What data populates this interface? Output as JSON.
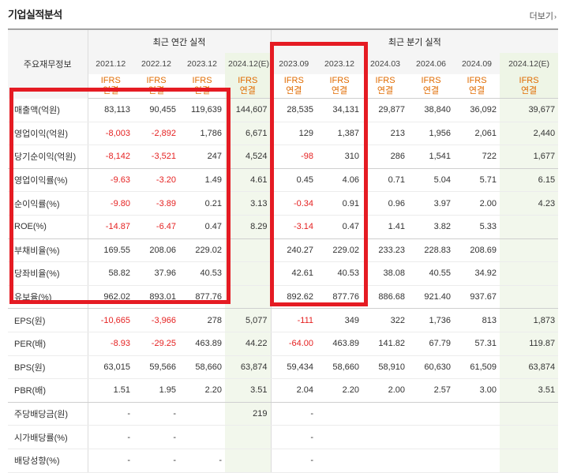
{
  "title": "기업실적분석",
  "more_label": "더보기",
  "label_header": "주요재무정보",
  "annual_header": "최근 연간 실적",
  "quarter_header": "최근 분기 실적",
  "periods": [
    "2021.12",
    "2022.12",
    "2023.12",
    "2024.12(E)",
    "2023.09",
    "2023.12",
    "2024.03",
    "2024.06",
    "2024.09",
    "2024.12(E)"
  ],
  "ifrs": {
    "line1": "IFRS",
    "line2": "연결"
  },
  "rows": [
    {
      "label": "매출액(억원)",
      "values": [
        "83,113",
        "90,455",
        "119,639",
        "144,607",
        "28,535",
        "34,131",
        "29,877",
        "38,840",
        "36,092",
        "39,677"
      ]
    },
    {
      "label": "영업이익(억원)",
      "values": [
        "-8,003",
        "-2,892",
        "1,786",
        "6,671",
        "129",
        "1,387",
        "213",
        "1,956",
        "2,061",
        "2,440"
      ]
    },
    {
      "label": "당기순이익(억원)",
      "values": [
        "-8,142",
        "-3,521",
        "247",
        "4,524",
        "-98",
        "310",
        "286",
        "1,541",
        "722",
        "1,677"
      ]
    },
    {
      "label": "영업이익률(%)",
      "values": [
        "-9.63",
        "-3.20",
        "1.49",
        "4.61",
        "0.45",
        "4.06",
        "0.71",
        "5.04",
        "5.71",
        "6.15"
      ]
    },
    {
      "label": "순이익률(%)",
      "values": [
        "-9.80",
        "-3.89",
        "0.21",
        "3.13",
        "-0.34",
        "0.91",
        "0.96",
        "3.97",
        "2.00",
        "4.23"
      ]
    },
    {
      "label": "ROE(%)",
      "values": [
        "-14.87",
        "-6.47",
        "0.47",
        "8.29",
        "-3.14",
        "0.47",
        "1.41",
        "3.82",
        "5.33",
        ""
      ]
    },
    {
      "label": "부채비율(%)",
      "values": [
        "169.55",
        "208.06",
        "229.02",
        "",
        "240.27",
        "229.02",
        "233.23",
        "228.83",
        "208.69",
        ""
      ]
    },
    {
      "label": "당좌비율(%)",
      "values": [
        "58.82",
        "37.96",
        "40.53",
        "",
        "42.61",
        "40.53",
        "38.08",
        "40.55",
        "34.92",
        ""
      ]
    },
    {
      "label": "유보율(%)",
      "values": [
        "962.02",
        "893.01",
        "877.76",
        "",
        "892.62",
        "877.76",
        "886.68",
        "921.40",
        "937.67",
        ""
      ]
    },
    {
      "label": "EPS(원)",
      "values": [
        "-10,665",
        "-3,966",
        "278",
        "5,077",
        "-111",
        "349",
        "322",
        "1,736",
        "813",
        "1,873"
      ]
    },
    {
      "label": "PER(배)",
      "values": [
        "-8.93",
        "-29.25",
        "463.89",
        "44.22",
        "-64.00",
        "463.89",
        "141.82",
        "67.79",
        "57.31",
        "119.87"
      ]
    },
    {
      "label": "BPS(원)",
      "values": [
        "63,015",
        "59,566",
        "58,660",
        "63,874",
        "59,434",
        "58,660",
        "58,910",
        "60,630",
        "61,509",
        "63,874"
      ]
    },
    {
      "label": "PBR(배)",
      "values": [
        "1.51",
        "1.95",
        "2.20",
        "3.51",
        "2.04",
        "2.20",
        "2.00",
        "2.57",
        "3.00",
        "3.51"
      ]
    },
    {
      "label": "주당배당금(원)",
      "values": [
        "-",
        "-",
        "",
        "219",
        "-",
        "",
        "",
        "",
        "",
        ""
      ]
    },
    {
      "label": "시가배당률(%)",
      "values": [
        "-",
        "-",
        "",
        "",
        "-",
        "",
        "",
        "",
        "",
        ""
      ]
    },
    {
      "label": "배당성향(%)",
      "values": [
        "-",
        "-",
        "-",
        "",
        "-",
        "",
        "",
        "",
        "",
        ""
      ]
    }
  ],
  "colors": {
    "negative": "#e52222",
    "ifrs": "#e06b00",
    "highlight_box": "#e51b23",
    "estimate_bg": "#f2f7ec"
  }
}
